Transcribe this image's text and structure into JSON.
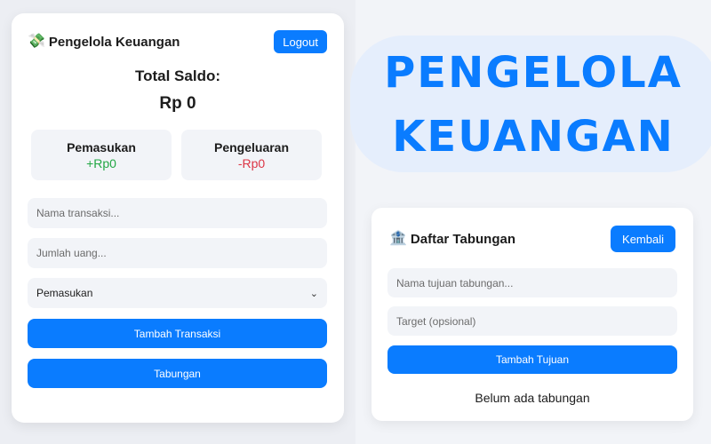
{
  "left_app": {
    "title": "Pengelola Keuangan",
    "title_emoji": "💸",
    "logout_label": "Logout",
    "total_label": "Total Saldo:",
    "total_value": "Rp 0",
    "income": {
      "label": "Pemasukan",
      "value": "+Rp0"
    },
    "expense": {
      "label": "Pengeluaran",
      "value": "-Rp0"
    },
    "name_placeholder": "Nama transaksi...",
    "amount_placeholder": "Jumlah uang...",
    "type_selected": "Pemasukan",
    "add_transaction_label": "Tambah Transaksi",
    "savings_label": "Tabungan"
  },
  "hero": {
    "line1": "PENGELOLA",
    "line2": "KEUANGAN"
  },
  "right_app": {
    "title": "Daftar Tabungan",
    "title_emoji": "🏦",
    "back_label": "Kembali",
    "goal_placeholder": "Nama tujuan tabungan...",
    "target_placeholder": "Target (opsional)",
    "add_goal_label": "Tambah Tujuan",
    "empty_text": "Belum ada tabungan"
  },
  "colors": {
    "accent": "#0a7cff",
    "income": "#22a744",
    "expense": "#dc3545"
  }
}
